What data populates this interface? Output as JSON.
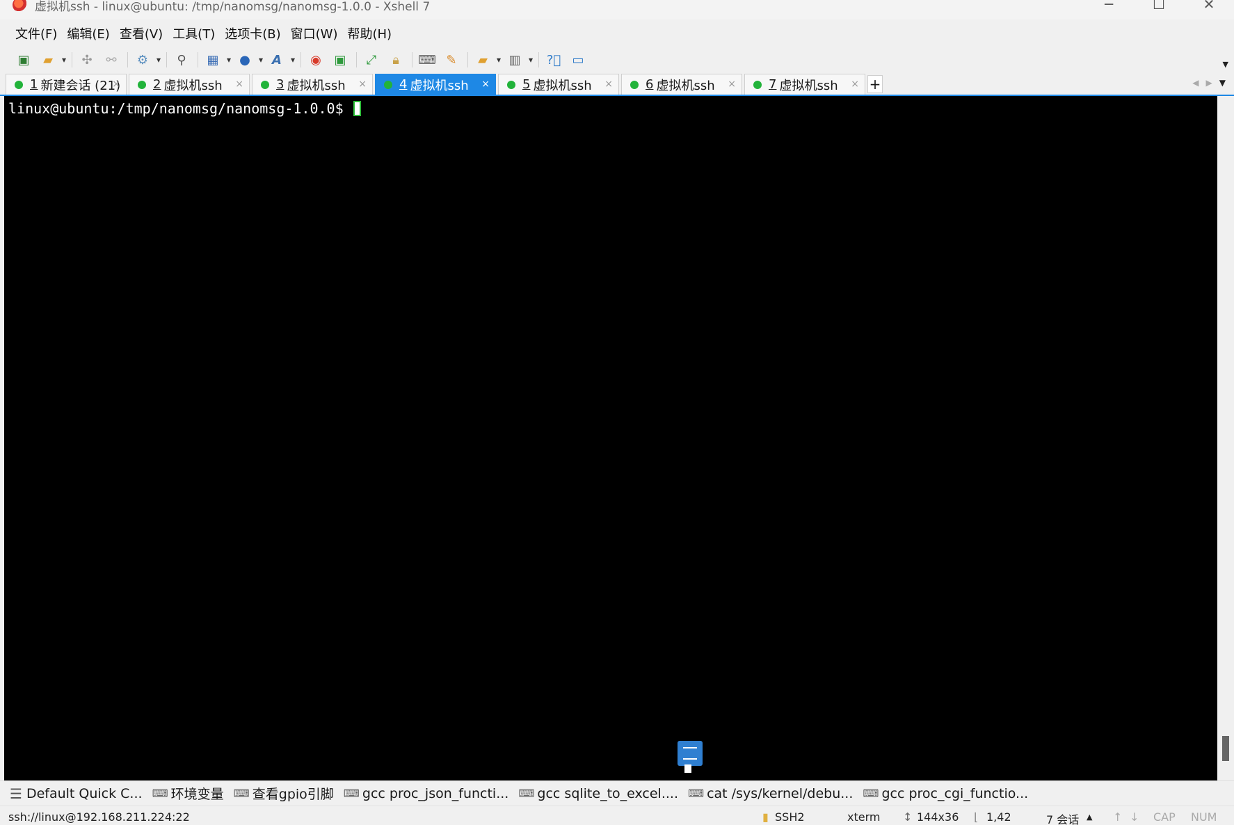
{
  "window": {
    "title": "虚拟机ssh - linux@ubuntu: /tmp/nanomsg/nanomsg-1.0.0 - Xshell 7",
    "controls": {
      "minimize": "─",
      "maximize": "☐",
      "close": "✕"
    }
  },
  "menu": [
    "文件(F)",
    "编辑(E)",
    "查看(V)",
    "工具(T)",
    "选项卡(B)",
    "窗口(W)",
    "帮助(H)"
  ],
  "tabs": [
    {
      "num": "1",
      "label": "新建会话 (21)",
      "active": false
    },
    {
      "num": "2",
      "label": "虚拟机ssh",
      "active": false
    },
    {
      "num": "3",
      "label": "虚拟机ssh",
      "active": false
    },
    {
      "num": "4",
      "label": "虚拟机ssh",
      "active": true
    },
    {
      "num": "5",
      "label": "虚拟机ssh",
      "active": false
    },
    {
      "num": "6",
      "label": "虚拟机ssh",
      "active": false
    },
    {
      "num": "7",
      "label": "虚拟机ssh",
      "active": false
    }
  ],
  "tab_close": "×",
  "tab_add": "+",
  "terminal": {
    "prompt": "linux@ubuntu:/tmp/nanomsg/nanomsg-1.0.0$ "
  },
  "quick_bar": {
    "items": [
      "Default Quick C...",
      "环境变量",
      "查看gpio引脚",
      "gcc proc_json_functi...",
      "gcc sqlite_to_excel....",
      "cat /sys/kernel/debu...",
      "gcc proc_cgi_functio..."
    ]
  },
  "status": {
    "connection": "ssh://linux@192.168.211.224:22",
    "protocol": "SSH2",
    "terminal_type": "xterm",
    "size": "144x36",
    "cursor_pos": "1,42",
    "sessions": "7 会话",
    "cap": "CAP",
    "num": "NUM"
  },
  "colors": {
    "tab_active": "#1e88e5",
    "session_dot": "#22b33a",
    "terminal_bg": "#000000",
    "cursor_border": "#2fbf3a"
  }
}
